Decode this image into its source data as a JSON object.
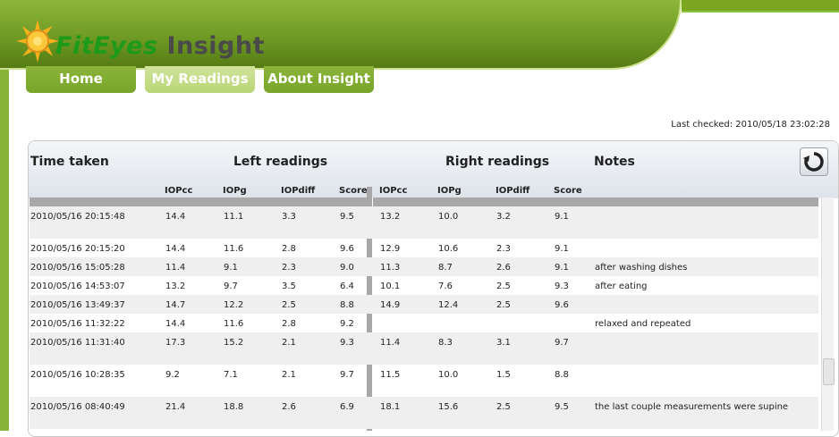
{
  "app": {
    "brand_fit": "FitEyes",
    "brand_rest": " Insight"
  },
  "nav": {
    "tabs": [
      {
        "label": "Home"
      },
      {
        "label": "My Readings"
      },
      {
        "label": "About Insight"
      }
    ]
  },
  "status": {
    "last_checked": "Last checked: 2010/05/18 23:02:28"
  },
  "table": {
    "headers": {
      "time": "Time taken",
      "left": "Left readings",
      "right": "Right readings",
      "notes": "Notes"
    },
    "subheaders": [
      "IOPcc",
      "IOPg",
      "IOPdiff",
      "Score",
      "IOPcc",
      "IOPg",
      "IOPdiff",
      "Score"
    ],
    "rows": [
      {
        "time": "2010/05/16 20:15:48",
        "l_cc": "14.4",
        "l_g": "11.1",
        "l_diff": "3.3",
        "l_score": "9.5",
        "r_cc": "13.2",
        "r_g": "10.0",
        "r_diff": "3.2",
        "r_score": "9.1",
        "note": ""
      },
      {
        "time": "2010/05/16 20:15:20",
        "l_cc": "14.4",
        "l_g": "11.6",
        "l_diff": "2.8",
        "l_score": "9.6",
        "r_cc": "12.9",
        "r_g": "10.6",
        "r_diff": "2.3",
        "r_score": "9.1",
        "note": ""
      },
      {
        "time": "2010/05/16 15:05:28",
        "l_cc": "11.4",
        "l_g": "9.1",
        "l_diff": "2.3",
        "l_score": "9.0",
        "r_cc": "11.3",
        "r_g": "8.7",
        "r_diff": "2.6",
        "r_score": "9.1",
        "note": "after washing dishes"
      },
      {
        "time": "2010/05/16 14:53:07",
        "l_cc": "13.2",
        "l_g": "9.7",
        "l_diff": "3.5",
        "l_score": "6.4",
        "r_cc": "10.1",
        "r_g": "7.6",
        "r_diff": "2.5",
        "r_score": "9.3",
        "note": "after eating"
      },
      {
        "time": "2010/05/16 13:49:37",
        "l_cc": "14.7",
        "l_g": "12.2",
        "l_diff": "2.5",
        "l_score": "8.8",
        "r_cc": "14.9",
        "r_g": "12.4",
        "r_diff": "2.5",
        "r_score": "9.6",
        "note": ""
      },
      {
        "time": "2010/05/16 11:32:22",
        "l_cc": "14.4",
        "l_g": "11.6",
        "l_diff": "2.8",
        "l_score": "9.2",
        "r_cc": "",
        "r_g": "",
        "r_diff": "",
        "r_score": "",
        "note": "relaxed and repeated"
      },
      {
        "time": "2010/05/16 11:31:40",
        "l_cc": "17.3",
        "l_g": "15.2",
        "l_diff": "2.1",
        "l_score": "9.3",
        "r_cc": "11.4",
        "r_g": "8.3",
        "r_diff": "3.1",
        "r_score": "9.7",
        "note": ""
      },
      {
        "time": "2010/05/16 10:28:35",
        "l_cc": "9.2",
        "l_g": "7.1",
        "l_diff": "2.1",
        "l_score": "9.7",
        "r_cc": "11.5",
        "r_g": "10.0",
        "r_diff": "1.5",
        "r_score": "8.8",
        "note": ""
      },
      {
        "time": "2010/05/16 08:40:49",
        "l_cc": "21.4",
        "l_g": "18.8",
        "l_diff": "2.6",
        "l_score": "6.9",
        "r_cc": "18.1",
        "r_g": "15.6",
        "r_diff": "2.5",
        "r_score": "9.5",
        "note": "the last couple measurements were supine"
      }
    ]
  }
}
